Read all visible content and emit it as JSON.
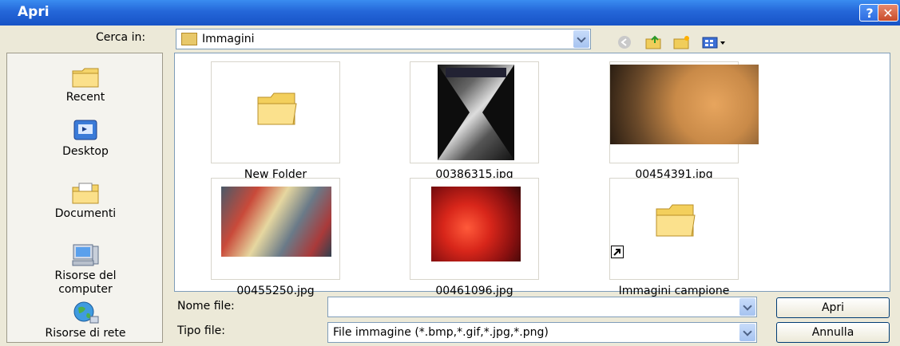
{
  "window": {
    "title": "Apri"
  },
  "lookin": {
    "label": "Cerca in:",
    "value": "Immagini"
  },
  "places": [
    {
      "label": "Recent"
    },
    {
      "label": "Desktop"
    },
    {
      "label": "Documenti"
    },
    {
      "label": "Risorse del computer"
    },
    {
      "label": "Risorse di rete"
    }
  ],
  "files": [
    {
      "name": "New Folder",
      "kind": "folder"
    },
    {
      "name": "00386315.jpg",
      "kind": "image"
    },
    {
      "name": "00454391.jpg",
      "kind": "image"
    },
    {
      "name": "00455250.jpg",
      "kind": "image"
    },
    {
      "name": "00461096.jpg",
      "kind": "image"
    },
    {
      "name": "Immagini campione",
      "kind": "folder-shortcut"
    }
  ],
  "filename": {
    "label": "Nome file:",
    "value": ""
  },
  "filetype": {
    "label": "Tipo file:",
    "value": "File immagine (*.bmp,*.gif,*.jpg,*.png)"
  },
  "buttons": {
    "open": "Apri",
    "cancel": "Annulla",
    "help": "?",
    "close": "✕"
  }
}
